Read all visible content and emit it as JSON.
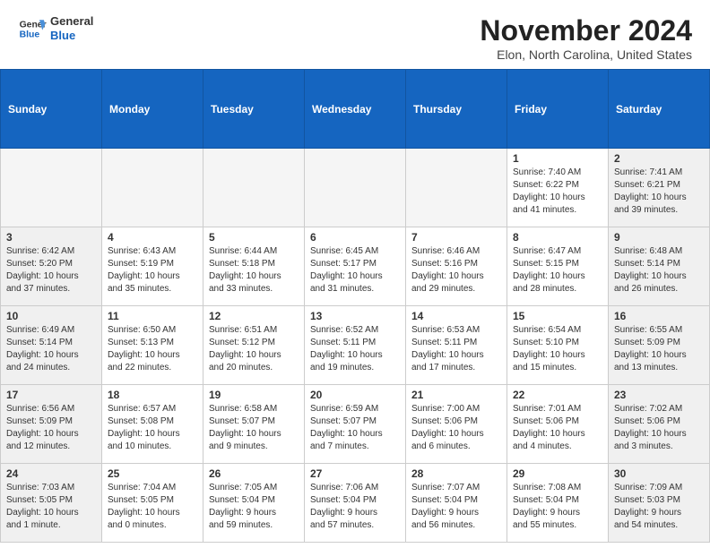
{
  "header": {
    "month_title": "November 2024",
    "location": "Elon, North Carolina, United States",
    "logo_general": "General",
    "logo_blue": "Blue"
  },
  "weekdays": [
    "Sunday",
    "Monday",
    "Tuesday",
    "Wednesday",
    "Thursday",
    "Friday",
    "Saturday"
  ],
  "weeks": [
    [
      {
        "day": "",
        "info": ""
      },
      {
        "day": "",
        "info": ""
      },
      {
        "day": "",
        "info": ""
      },
      {
        "day": "",
        "info": ""
      },
      {
        "day": "",
        "info": ""
      },
      {
        "day": "1",
        "info": "Sunrise: 7:40 AM\nSunset: 6:22 PM\nDaylight: 10 hours\nand 41 minutes."
      },
      {
        "day": "2",
        "info": "Sunrise: 7:41 AM\nSunset: 6:21 PM\nDaylight: 10 hours\nand 39 minutes."
      }
    ],
    [
      {
        "day": "3",
        "info": "Sunrise: 6:42 AM\nSunset: 5:20 PM\nDaylight: 10 hours\nand 37 minutes."
      },
      {
        "day": "4",
        "info": "Sunrise: 6:43 AM\nSunset: 5:19 PM\nDaylight: 10 hours\nand 35 minutes."
      },
      {
        "day": "5",
        "info": "Sunrise: 6:44 AM\nSunset: 5:18 PM\nDaylight: 10 hours\nand 33 minutes."
      },
      {
        "day": "6",
        "info": "Sunrise: 6:45 AM\nSunset: 5:17 PM\nDaylight: 10 hours\nand 31 minutes."
      },
      {
        "day": "7",
        "info": "Sunrise: 6:46 AM\nSunset: 5:16 PM\nDaylight: 10 hours\nand 29 minutes."
      },
      {
        "day": "8",
        "info": "Sunrise: 6:47 AM\nSunset: 5:15 PM\nDaylight: 10 hours\nand 28 minutes."
      },
      {
        "day": "9",
        "info": "Sunrise: 6:48 AM\nSunset: 5:14 PM\nDaylight: 10 hours\nand 26 minutes."
      }
    ],
    [
      {
        "day": "10",
        "info": "Sunrise: 6:49 AM\nSunset: 5:14 PM\nDaylight: 10 hours\nand 24 minutes."
      },
      {
        "day": "11",
        "info": "Sunrise: 6:50 AM\nSunset: 5:13 PM\nDaylight: 10 hours\nand 22 minutes."
      },
      {
        "day": "12",
        "info": "Sunrise: 6:51 AM\nSunset: 5:12 PM\nDaylight: 10 hours\nand 20 minutes."
      },
      {
        "day": "13",
        "info": "Sunrise: 6:52 AM\nSunset: 5:11 PM\nDaylight: 10 hours\nand 19 minutes."
      },
      {
        "day": "14",
        "info": "Sunrise: 6:53 AM\nSunset: 5:11 PM\nDaylight: 10 hours\nand 17 minutes."
      },
      {
        "day": "15",
        "info": "Sunrise: 6:54 AM\nSunset: 5:10 PM\nDaylight: 10 hours\nand 15 minutes."
      },
      {
        "day": "16",
        "info": "Sunrise: 6:55 AM\nSunset: 5:09 PM\nDaylight: 10 hours\nand 13 minutes."
      }
    ],
    [
      {
        "day": "17",
        "info": "Sunrise: 6:56 AM\nSunset: 5:09 PM\nDaylight: 10 hours\nand 12 minutes."
      },
      {
        "day": "18",
        "info": "Sunrise: 6:57 AM\nSunset: 5:08 PM\nDaylight: 10 hours\nand 10 minutes."
      },
      {
        "day": "19",
        "info": "Sunrise: 6:58 AM\nSunset: 5:07 PM\nDaylight: 10 hours\nand 9 minutes."
      },
      {
        "day": "20",
        "info": "Sunrise: 6:59 AM\nSunset: 5:07 PM\nDaylight: 10 hours\nand 7 minutes."
      },
      {
        "day": "21",
        "info": "Sunrise: 7:00 AM\nSunset: 5:06 PM\nDaylight: 10 hours\nand 6 minutes."
      },
      {
        "day": "22",
        "info": "Sunrise: 7:01 AM\nSunset: 5:06 PM\nDaylight: 10 hours\nand 4 minutes."
      },
      {
        "day": "23",
        "info": "Sunrise: 7:02 AM\nSunset: 5:06 PM\nDaylight: 10 hours\nand 3 minutes."
      }
    ],
    [
      {
        "day": "24",
        "info": "Sunrise: 7:03 AM\nSunset: 5:05 PM\nDaylight: 10 hours\nand 1 minute."
      },
      {
        "day": "25",
        "info": "Sunrise: 7:04 AM\nSunset: 5:05 PM\nDaylight: 10 hours\nand 0 minutes."
      },
      {
        "day": "26",
        "info": "Sunrise: 7:05 AM\nSunset: 5:04 PM\nDaylight: 9 hours\nand 59 minutes."
      },
      {
        "day": "27",
        "info": "Sunrise: 7:06 AM\nSunset: 5:04 PM\nDaylight: 9 hours\nand 57 minutes."
      },
      {
        "day": "28",
        "info": "Sunrise: 7:07 AM\nSunset: 5:04 PM\nDaylight: 9 hours\nand 56 minutes."
      },
      {
        "day": "29",
        "info": "Sunrise: 7:08 AM\nSunset: 5:04 PM\nDaylight: 9 hours\nand 55 minutes."
      },
      {
        "day": "30",
        "info": "Sunrise: 7:09 AM\nSunset: 5:03 PM\nDaylight: 9 hours\nand 54 minutes."
      }
    ]
  ]
}
